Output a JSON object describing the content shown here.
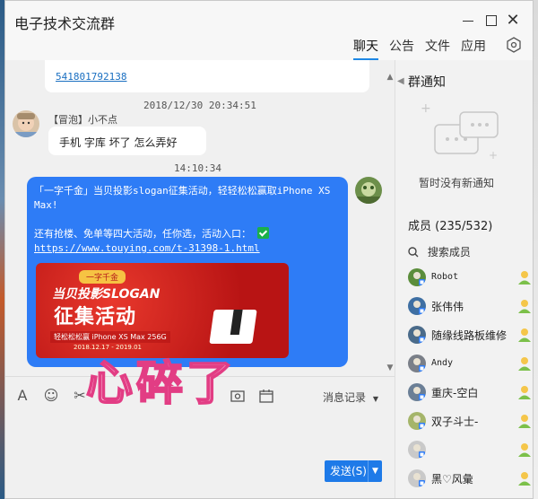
{
  "window": {
    "title": "电子技术交流群",
    "close_glyph": "✕"
  },
  "tabs": [
    {
      "label": "聊天",
      "active": true
    },
    {
      "label": "公告",
      "active": false
    },
    {
      "label": "文件",
      "active": false
    },
    {
      "label": "应用",
      "active": false
    }
  ],
  "chat": {
    "prev_link": "541801792138",
    "timestamp1": "2018/12/30 20:34:51",
    "sender1": "【冒泡】小不点",
    "message1": "手机 字库 坏了 怎么弄好",
    "timestamp2": "14:10:34",
    "message2_line1": "「一字千金」当贝投影slogan征集活动，轻轻松松赢取iPhone XS Max!",
    "message2_line2": "还有抢楼、免单等四大活动，任你选，活动入口：",
    "message2_link": "https://www.touying.com/t-31398-1.html",
    "promo": {
      "tag": "一字千金",
      "line1": "当贝投影SLOGAN",
      "line2": "征集活动",
      "line3": "轻松松松赢 iPhone XS Max 256G",
      "line4": "2018.12.17 - 2019.01"
    },
    "overlay": "心碎了"
  },
  "toolbar": {
    "font_glyph": "A",
    "emoji_glyph": "☺",
    "scissors_glyph": "✂",
    "history_label": "消息记录",
    "history_caret": "▼"
  },
  "send": {
    "label": "发送(S)",
    "caret": "▼"
  },
  "sidebar": {
    "notice_title": "群通知",
    "notice_empty": "暂时没有新通知",
    "members_header": "成员 (235/532)",
    "search_label": "搜索成员",
    "search_glyph": "○",
    "members": [
      {
        "name": "Robot",
        "mono": true
      },
      {
        "name": "张伟伟",
        "mono": false
      },
      {
        "name": "随缘线路板维修",
        "mono": false
      },
      {
        "name": "Andy",
        "mono": true
      },
      {
        "name": "重庆-空白",
        "mono": false
      },
      {
        "name": "双子斗士-",
        "mono": false
      },
      {
        "name": "",
        "mono": false
      },
      {
        "name": "黑♡风彙",
        "mono": false
      }
    ]
  },
  "colors": {
    "accent": "#1e7ae8",
    "bubble_blue": "#2e7cf6",
    "link": "#1a6fc1",
    "green_check": "#1ab04a"
  }
}
